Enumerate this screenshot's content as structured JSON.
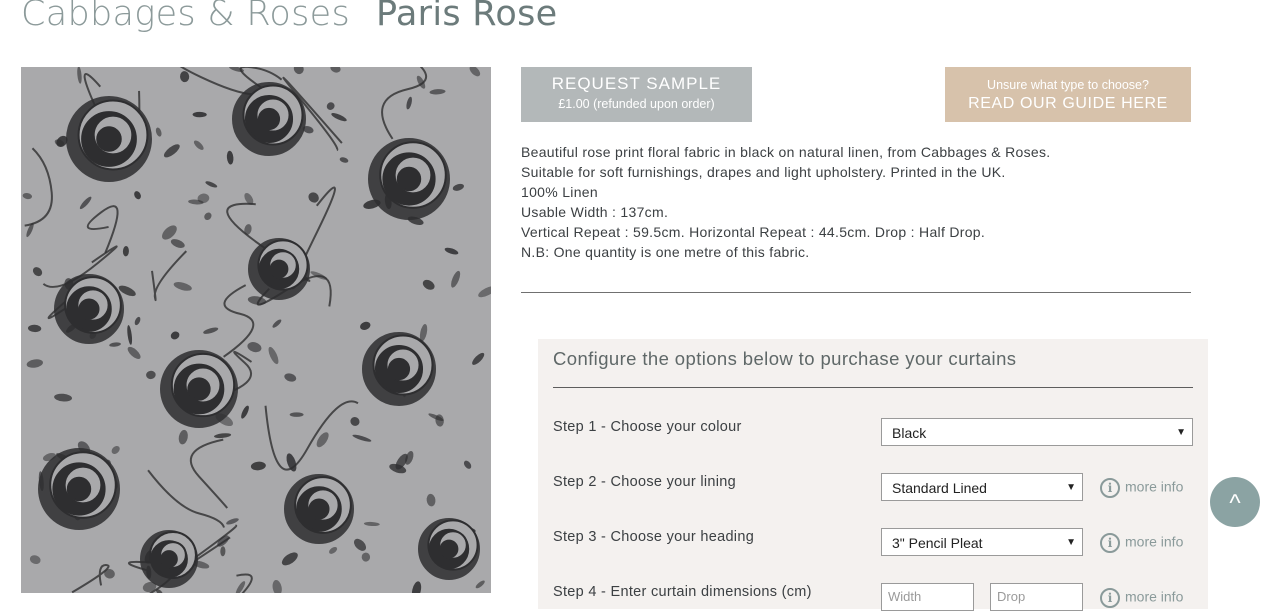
{
  "title": {
    "brand": "Cabbages & Roses",
    "product": "Paris Rose"
  },
  "image": {
    "alt": "Paris Rose fabric swatch",
    "colors": {
      "background": "#a9a9ab",
      "print": "#2e2e30"
    }
  },
  "sample_button": {
    "label": "REQUEST SAMPLE",
    "sub": "£1.00 (refunded upon order)"
  },
  "guide_button": {
    "line1": "Unsure what type to choose?",
    "line2": "READ OUR GUIDE HERE"
  },
  "description": [
    "Beautiful rose print floral fabric in black on natural linen, from Cabbages & Roses.",
    "Suitable for soft furnishings, drapes and light upholstery. Printed in the UK.",
    "100% Linen",
    "Usable Width : 137cm.",
    "Vertical Repeat : 59.5cm. Horizontal Repeat : 44.5cm. Drop : Half Drop.",
    "N.B: One quantity is one metre of this fabric."
  ],
  "config": {
    "heading": "Configure the options below to purchase your curtains",
    "steps": [
      {
        "label": "Step 1 - Choose your colour",
        "value": "Black"
      },
      {
        "label": "Step 2 - Choose your lining",
        "value": "Standard Lined",
        "info": "more info"
      },
      {
        "label": "Step 3 - Choose your heading",
        "value": "3\" Pencil Pleat",
        "info": "more info"
      },
      {
        "label": "Step 4 - Enter curtain dimensions (cm)",
        "width_placeholder": "Width",
        "drop_placeholder": "Drop",
        "info": "more info"
      }
    ]
  },
  "back_to_top": {
    "icon": "chevron-up-icon",
    "glyph": "^"
  },
  "colors": {
    "accent_sample": "#b3b8b9",
    "accent_guide": "#d7c2ab",
    "panel": "#f4f1ef",
    "to_top": "#8ba3a3"
  }
}
